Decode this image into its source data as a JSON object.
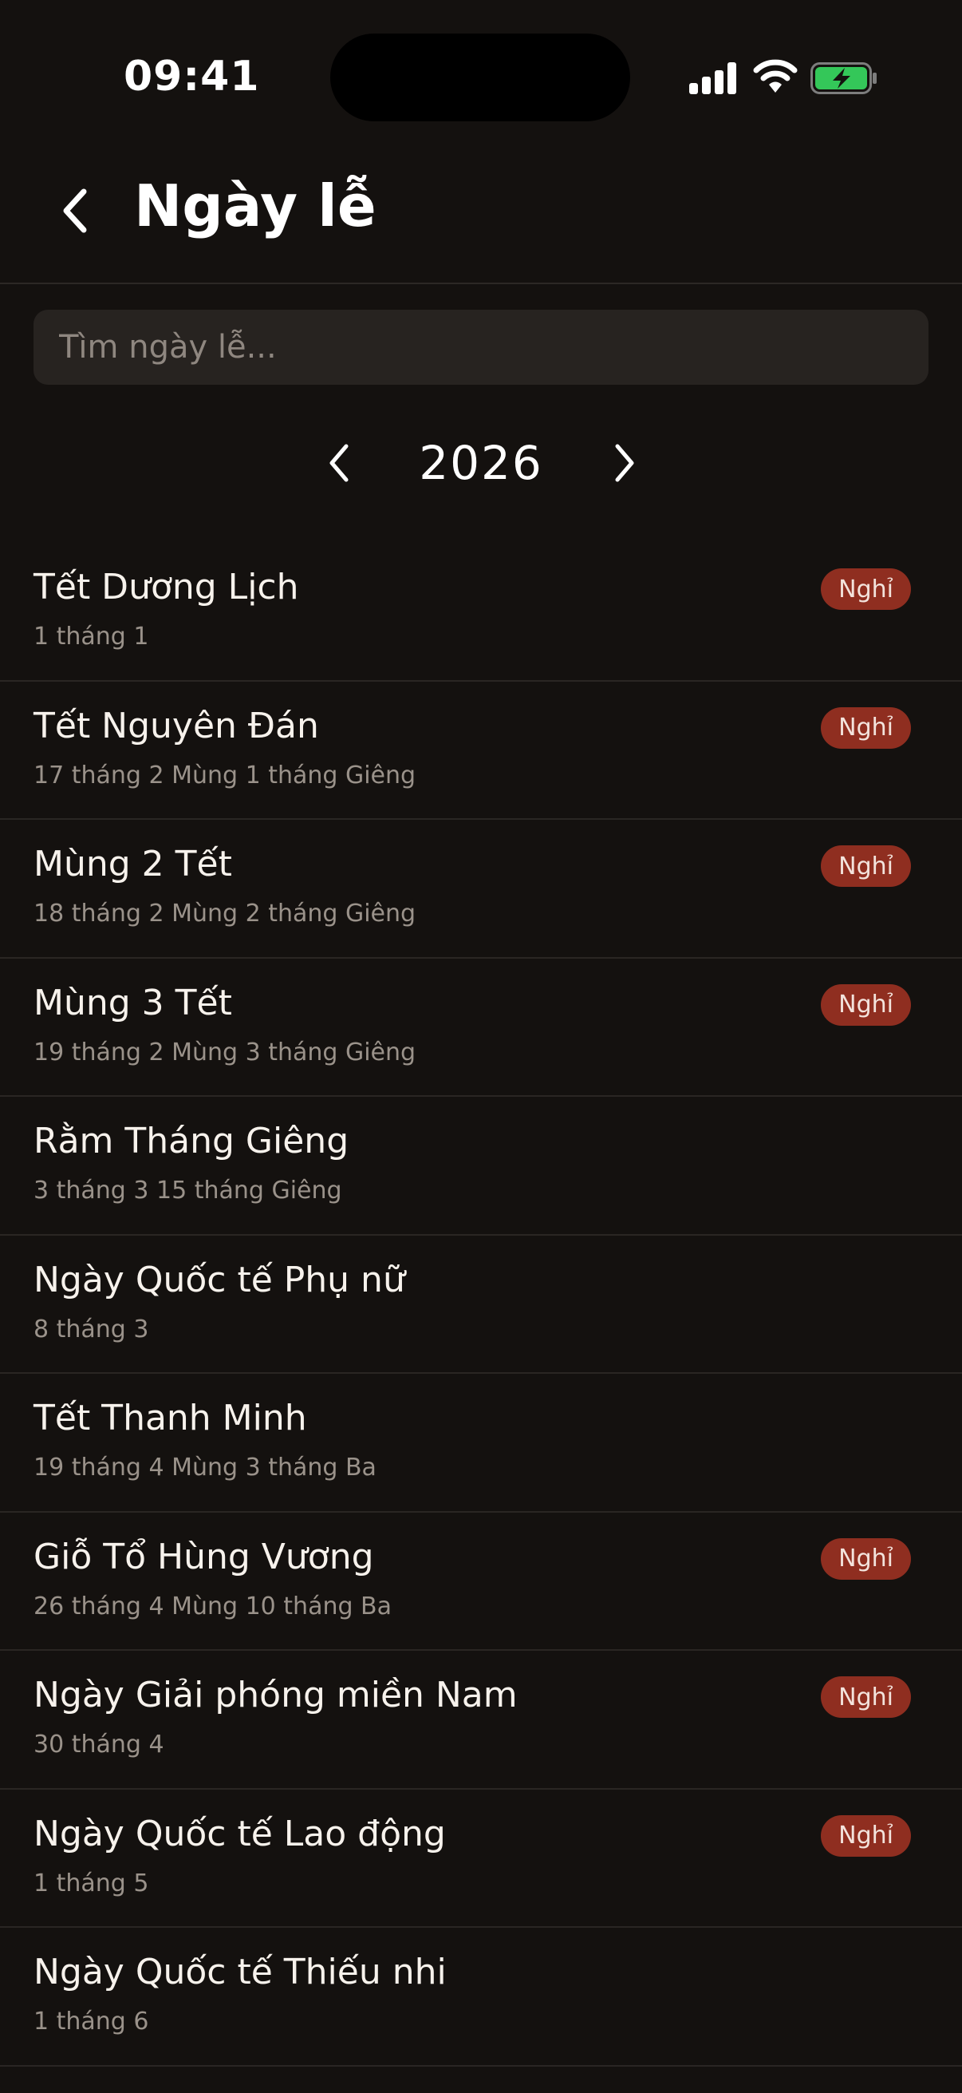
{
  "status": {
    "time": "09:41"
  },
  "header": {
    "title": "Ngày lễ"
  },
  "search": {
    "placeholder": "Tìm ngày lễ..."
  },
  "year": {
    "label": "2026"
  },
  "colors": {
    "background": "#14110f",
    "badge": "#8f2e20",
    "battery": "#34c759"
  },
  "icons": {
    "back": "chevron-left-icon",
    "prev_year": "chevron-left-icon",
    "next_year": "chevron-right-icon",
    "signal": "signal-icon",
    "wifi": "wifi-icon",
    "battery": "battery-charging-icon"
  },
  "holidays": [
    {
      "name": "Tết Dương Lịch",
      "date": "1 tháng 1",
      "badge": "Nghỉ"
    },
    {
      "name": "Tết Nguyên Đán",
      "date": "17 tháng 2 Mùng 1 tháng Giêng",
      "badge": "Nghỉ"
    },
    {
      "name": "Mùng 2 Tết",
      "date": "18 tháng 2 Mùng 2 tháng Giêng",
      "badge": "Nghỉ"
    },
    {
      "name": "Mùng 3 Tết",
      "date": "19 tháng 2 Mùng 3 tháng Giêng",
      "badge": "Nghỉ"
    },
    {
      "name": "Rằm Tháng Giêng",
      "date": "3 tháng 3 15 tháng Giêng",
      "badge": ""
    },
    {
      "name": "Ngày Quốc tế Phụ nữ",
      "date": "8 tháng 3",
      "badge": ""
    },
    {
      "name": "Tết Thanh Minh",
      "date": "19 tháng 4 Mùng 3 tháng Ba",
      "badge": ""
    },
    {
      "name": "Giỗ Tổ Hùng Vương",
      "date": "26 tháng 4 Mùng 10 tháng Ba",
      "badge": "Nghỉ"
    },
    {
      "name": "Ngày Giải phóng miền Nam",
      "date": "30 tháng 4",
      "badge": "Nghỉ"
    },
    {
      "name": "Ngày Quốc tế Lao động",
      "date": "1 tháng 5",
      "badge": "Nghỉ"
    },
    {
      "name": "Ngày Quốc tế Thiếu nhi",
      "date": "1 tháng 6",
      "badge": ""
    }
  ]
}
